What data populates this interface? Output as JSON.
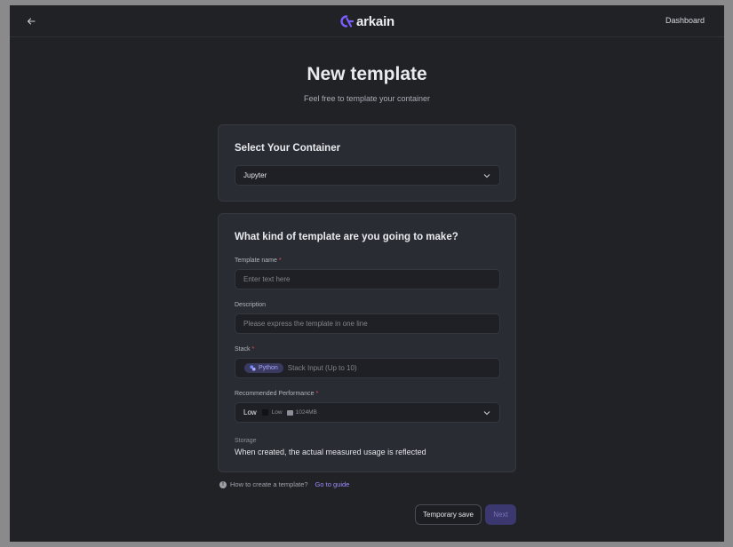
{
  "header": {
    "logo_text": "arkain",
    "dashboard_label": "Dashboard",
    "accent_color": "#7b5cff"
  },
  "page": {
    "title": "New template",
    "subtitle": "Feel free to template your container"
  },
  "container_card": {
    "title": "Select Your Container",
    "select_value": "Jupyter"
  },
  "template_card": {
    "title": "What kind of template are you going to make?",
    "name_label": "Template name",
    "name_placeholder": "Enter text here",
    "description_label": "Description",
    "description_placeholder": "Please express the template in one line",
    "stack_label": "Stack",
    "stack_chip": "Python",
    "stack_placeholder": "Stack Input (Up to 10)",
    "performance_label": "Recommended Performance",
    "performance_value": "Low",
    "performance_sub_label": "Low",
    "performance_memory": "1024MB",
    "storage_label": "Storage",
    "storage_text": "When created, the actual measured usage is reflected",
    "required_mark": "*"
  },
  "footer": {
    "help_text": "How to create a template?",
    "guide_link": "Go to guide",
    "temp_save_label": "Temporary save",
    "next_label": "Next"
  }
}
